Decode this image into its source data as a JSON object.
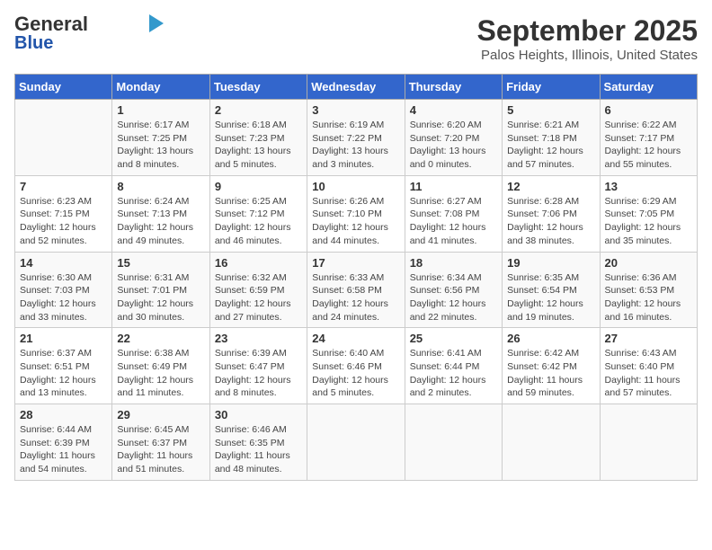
{
  "logo": {
    "text1": "General",
    "text2": "Blue"
  },
  "title": "September 2025",
  "subtitle": "Palos Heights, Illinois, United States",
  "weekdays": [
    "Sunday",
    "Monday",
    "Tuesday",
    "Wednesday",
    "Thursday",
    "Friday",
    "Saturday"
  ],
  "weeks": [
    [
      {
        "day": "",
        "info": ""
      },
      {
        "day": "1",
        "info": "Sunrise: 6:17 AM\nSunset: 7:25 PM\nDaylight: 13 hours\nand 8 minutes."
      },
      {
        "day": "2",
        "info": "Sunrise: 6:18 AM\nSunset: 7:23 PM\nDaylight: 13 hours\nand 5 minutes."
      },
      {
        "day": "3",
        "info": "Sunrise: 6:19 AM\nSunset: 7:22 PM\nDaylight: 13 hours\nand 3 minutes."
      },
      {
        "day": "4",
        "info": "Sunrise: 6:20 AM\nSunset: 7:20 PM\nDaylight: 13 hours\nand 0 minutes."
      },
      {
        "day": "5",
        "info": "Sunrise: 6:21 AM\nSunset: 7:18 PM\nDaylight: 12 hours\nand 57 minutes."
      },
      {
        "day": "6",
        "info": "Sunrise: 6:22 AM\nSunset: 7:17 PM\nDaylight: 12 hours\nand 55 minutes."
      }
    ],
    [
      {
        "day": "7",
        "info": "Sunrise: 6:23 AM\nSunset: 7:15 PM\nDaylight: 12 hours\nand 52 minutes."
      },
      {
        "day": "8",
        "info": "Sunrise: 6:24 AM\nSunset: 7:13 PM\nDaylight: 12 hours\nand 49 minutes."
      },
      {
        "day": "9",
        "info": "Sunrise: 6:25 AM\nSunset: 7:12 PM\nDaylight: 12 hours\nand 46 minutes."
      },
      {
        "day": "10",
        "info": "Sunrise: 6:26 AM\nSunset: 7:10 PM\nDaylight: 12 hours\nand 44 minutes."
      },
      {
        "day": "11",
        "info": "Sunrise: 6:27 AM\nSunset: 7:08 PM\nDaylight: 12 hours\nand 41 minutes."
      },
      {
        "day": "12",
        "info": "Sunrise: 6:28 AM\nSunset: 7:06 PM\nDaylight: 12 hours\nand 38 minutes."
      },
      {
        "day": "13",
        "info": "Sunrise: 6:29 AM\nSunset: 7:05 PM\nDaylight: 12 hours\nand 35 minutes."
      }
    ],
    [
      {
        "day": "14",
        "info": "Sunrise: 6:30 AM\nSunset: 7:03 PM\nDaylight: 12 hours\nand 33 minutes."
      },
      {
        "day": "15",
        "info": "Sunrise: 6:31 AM\nSunset: 7:01 PM\nDaylight: 12 hours\nand 30 minutes."
      },
      {
        "day": "16",
        "info": "Sunrise: 6:32 AM\nSunset: 6:59 PM\nDaylight: 12 hours\nand 27 minutes."
      },
      {
        "day": "17",
        "info": "Sunrise: 6:33 AM\nSunset: 6:58 PM\nDaylight: 12 hours\nand 24 minutes."
      },
      {
        "day": "18",
        "info": "Sunrise: 6:34 AM\nSunset: 6:56 PM\nDaylight: 12 hours\nand 22 minutes."
      },
      {
        "day": "19",
        "info": "Sunrise: 6:35 AM\nSunset: 6:54 PM\nDaylight: 12 hours\nand 19 minutes."
      },
      {
        "day": "20",
        "info": "Sunrise: 6:36 AM\nSunset: 6:53 PM\nDaylight: 12 hours\nand 16 minutes."
      }
    ],
    [
      {
        "day": "21",
        "info": "Sunrise: 6:37 AM\nSunset: 6:51 PM\nDaylight: 12 hours\nand 13 minutes."
      },
      {
        "day": "22",
        "info": "Sunrise: 6:38 AM\nSunset: 6:49 PM\nDaylight: 12 hours\nand 11 minutes."
      },
      {
        "day": "23",
        "info": "Sunrise: 6:39 AM\nSunset: 6:47 PM\nDaylight: 12 hours\nand 8 minutes."
      },
      {
        "day": "24",
        "info": "Sunrise: 6:40 AM\nSunset: 6:46 PM\nDaylight: 12 hours\nand 5 minutes."
      },
      {
        "day": "25",
        "info": "Sunrise: 6:41 AM\nSunset: 6:44 PM\nDaylight: 12 hours\nand 2 minutes."
      },
      {
        "day": "26",
        "info": "Sunrise: 6:42 AM\nSunset: 6:42 PM\nDaylight: 11 hours\nand 59 minutes."
      },
      {
        "day": "27",
        "info": "Sunrise: 6:43 AM\nSunset: 6:40 PM\nDaylight: 11 hours\nand 57 minutes."
      }
    ],
    [
      {
        "day": "28",
        "info": "Sunrise: 6:44 AM\nSunset: 6:39 PM\nDaylight: 11 hours\nand 54 minutes."
      },
      {
        "day": "29",
        "info": "Sunrise: 6:45 AM\nSunset: 6:37 PM\nDaylight: 11 hours\nand 51 minutes."
      },
      {
        "day": "30",
        "info": "Sunrise: 6:46 AM\nSunset: 6:35 PM\nDaylight: 11 hours\nand 48 minutes."
      },
      {
        "day": "",
        "info": ""
      },
      {
        "day": "",
        "info": ""
      },
      {
        "day": "",
        "info": ""
      },
      {
        "day": "",
        "info": ""
      }
    ]
  ]
}
